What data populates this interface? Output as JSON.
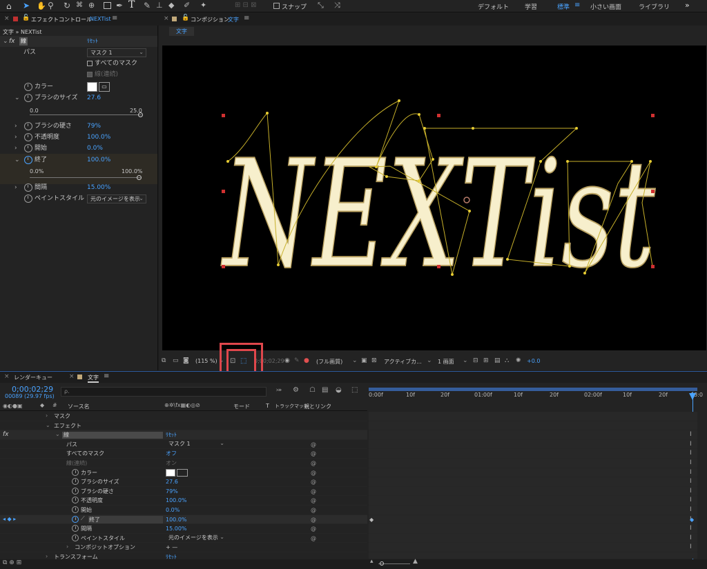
{
  "toolbar": {
    "snap": "スナップ",
    "workspaces": [
      "デフォルト",
      "学習",
      "標準",
      "小さい画面",
      "ライブラリ"
    ],
    "active_workspace": "標準",
    "more": "»"
  },
  "effect_panel": {
    "tab": "エフェクトコントロール",
    "layer_name": "NEXTist",
    "breadcrumb": "文字 » NEXTist",
    "effect_name": "線",
    "reset": "ﾘｾｯﾄ",
    "props": {
      "path_label": "パス",
      "path_value": "マスク 1",
      "all_masks": "すべてのマスク",
      "stroke_seq": "線(連続)",
      "color": "カラー",
      "brush_size": "ブラシのサイズ",
      "brush_size_val": "27.6",
      "range_min": "0.0",
      "range_max": "25.0",
      "hardness": "ブラシの硬さ",
      "hardness_val": "79%",
      "opacity": "不透明度",
      "opacity_val": "100.0%",
      "start": "開始",
      "start_val": "0.0%",
      "end": "終了",
      "end_val": "100.0%",
      "end_min": "0.0%",
      "end_max": "100.0%",
      "spacing": "間隔",
      "spacing_val": "15.00%",
      "paint_style": "ペイントスタイル",
      "paint_style_val": "元のイメージを表示"
    }
  },
  "comp_panel": {
    "tab_prefix": "コンポジション",
    "comp_name": "文字",
    "sub_tab": "文字",
    "canvas_text": "NEXTist",
    "footer": {
      "zoom": "(115 %)",
      "time": "0;00;02;29",
      "quality": "(フル画質)",
      "camera": "アクティブカ...",
      "views": "1 画面",
      "exposure": "+0.0"
    }
  },
  "timeline": {
    "render_queue_tab": "レンダーキュー",
    "comp_tab": "文字",
    "timecode": "0;00;02;29",
    "frames": "00089 (29.97 fps)",
    "search_placeholder": "ρ.",
    "col_source": "ソース名",
    "col_mode": "モード",
    "col_t": "T",
    "col_trackmatte": "トラックマット",
    "col_parent": "親とリンク",
    "ruler": [
      "0:00f",
      "10f",
      "20f",
      "01:00f",
      "10f",
      "20f",
      "02:00f",
      "10f",
      "20f",
      "03:0"
    ],
    "rows": [
      {
        "label": "マスク",
        "indent": 1,
        "tw": true
      },
      {
        "label": "エフェクト",
        "indent": 1,
        "tw": true,
        "open": true
      },
      {
        "label": "線",
        "indent": 2,
        "tw": true,
        "open": true,
        "fx": true,
        "value": "ﾘｾｯﾄ",
        "value_blue": true
      },
      {
        "label": "パス",
        "indent": 3,
        "value": "マスク 1",
        "dropdown": true
      },
      {
        "label": "すべてのマスク",
        "indent": 3,
        "value": "オフ",
        "value_blue": true
      },
      {
        "label": "線(連続)",
        "indent": 3,
        "value": "オン",
        "dim": true
      },
      {
        "label": "カラー",
        "indent": 3,
        "stopwatch": true,
        "swatch": true
      },
      {
        "label": "ブラシのサイズ",
        "indent": 3,
        "stopwatch": true,
        "value": "27.6",
        "value_blue": true
      },
      {
        "label": "ブラシの硬さ",
        "indent": 3,
        "stopwatch": true,
        "value": "79%",
        "value_blue": true
      },
      {
        "label": "不透明度",
        "indent": 3,
        "stopwatch": true,
        "value": "100.0%",
        "value_blue": true
      },
      {
        "label": "開始",
        "indent": 3,
        "stopwatch": true,
        "value": "0.0%",
        "value_blue": true
      },
      {
        "label": "終了",
        "indent": 3,
        "stopwatch": true,
        "value": "100.0%",
        "value_blue": true,
        "keyed": true
      },
      {
        "label": "間隔",
        "indent": 3,
        "stopwatch": true,
        "value": "15.00%",
        "value_blue": true
      },
      {
        "label": "ペイントスタイル",
        "indent": 3,
        "stopwatch": true,
        "value": "元のイメージを表示",
        "dropdown": true
      },
      {
        "label": "コンポジットオプション",
        "indent": 3,
        "tw": true,
        "value": "+ —"
      },
      {
        "label": "トランスフォーム",
        "indent": 1,
        "tw": true,
        "value": "ﾘｾｯﾄ",
        "value_blue": true
      }
    ]
  },
  "colors": {
    "accent": "#4aa3ff",
    "highlight": "#e0474c",
    "stroke": "#f7efcc",
    "path": "#c7b02a"
  }
}
